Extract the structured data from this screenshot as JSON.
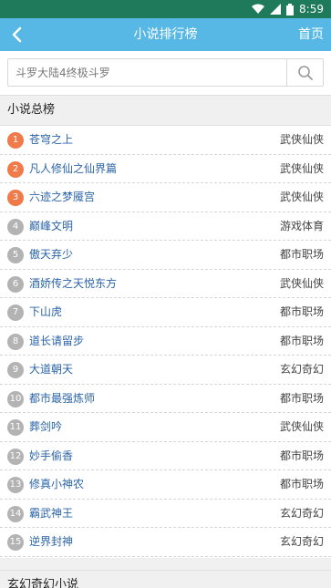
{
  "status_bar": {
    "time": "8:59"
  },
  "app_bar": {
    "title": "小说排行榜",
    "home_label": "首页"
  },
  "search": {
    "placeholder": "斗罗大陆4终极斗罗"
  },
  "section": {
    "title": "小说总榜"
  },
  "books": [
    {
      "rank": "1",
      "title": "苍穹之上",
      "category": "武侠仙侠"
    },
    {
      "rank": "2",
      "title": "凡人修仙之仙界篇",
      "category": "武侠仙侠"
    },
    {
      "rank": "3",
      "title": "六迹之梦魇宫",
      "category": "武侠仙侠"
    },
    {
      "rank": "4",
      "title": "巅峰文明",
      "category": "游戏体育"
    },
    {
      "rank": "5",
      "title": "傲天弃少",
      "category": "都市职场"
    },
    {
      "rank": "6",
      "title": "酒娇传之天悦东方",
      "category": "武侠仙侠"
    },
    {
      "rank": "7",
      "title": "下山虎",
      "category": "都市职场"
    },
    {
      "rank": "8",
      "title": "道长请留步",
      "category": "都市职场"
    },
    {
      "rank": "9",
      "title": "大道朝天",
      "category": "玄幻奇幻"
    },
    {
      "rank": "10",
      "title": "都市最强炼师",
      "category": "都市职场"
    },
    {
      "rank": "11",
      "title": "葬剑吟",
      "category": "武侠仙侠"
    },
    {
      "rank": "12",
      "title": "妙手偷香",
      "category": "都市职场"
    },
    {
      "rank": "13",
      "title": "修真小神农",
      "category": "都市职场"
    },
    {
      "rank": "14",
      "title": "霸武神王",
      "category": "玄幻奇幻"
    },
    {
      "rank": "15",
      "title": "逆界封神",
      "category": "玄幻奇幻"
    }
  ],
  "next_section": {
    "title": "玄幻奇幻小说"
  },
  "colors": {
    "status_bar": "#1f7a5c",
    "app_bar": "#57b8e6",
    "top_badge": "#f07a4a",
    "badge": "#b3b3b3",
    "title_link": "#2b64a8"
  }
}
